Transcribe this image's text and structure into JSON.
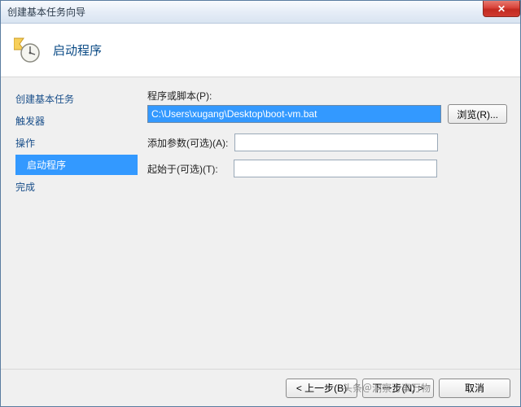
{
  "window": {
    "title": "创建基本任务向导",
    "close_glyph": "✕"
  },
  "header": {
    "title": "启动程序"
  },
  "sidebar": {
    "items": [
      {
        "label": "创建基本任务",
        "selected": false,
        "sub": false
      },
      {
        "label": "触发器",
        "selected": false,
        "sub": false
      },
      {
        "label": "操作",
        "selected": false,
        "sub": false
      },
      {
        "label": "启动程序",
        "selected": true,
        "sub": true
      },
      {
        "label": "完成",
        "selected": false,
        "sub": false
      }
    ]
  },
  "form": {
    "program_label": "程序或脚本(P):",
    "program_value": "C:\\Users\\xugang\\Desktop\\boot-vm.bat",
    "browse_label": "浏览(R)...",
    "args_label": "添加参数(可选)(A):",
    "args_value": "",
    "startin_label": "起始于(可选)(T):",
    "startin_value": ""
  },
  "footer": {
    "back_label": "< 上一步(B)",
    "next_label": "下一步(N) >",
    "cancel_label": "取消"
  },
  "watermark": "头条＠洞察万事万物"
}
